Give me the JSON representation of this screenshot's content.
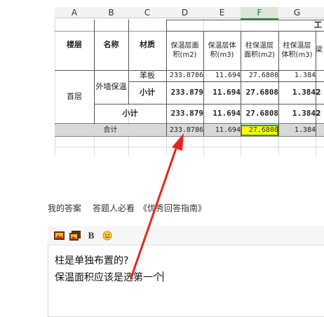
{
  "sheet": {
    "columns": [
      "A",
      "B",
      "C",
      "D",
      "E",
      "F",
      "G"
    ],
    "selected_column": "F",
    "header": {
      "group_label_partial": "工",
      "floor": "楼层",
      "name": "名称",
      "material": "材质",
      "d": [
        "保温层面",
        "积(m2)"
      ],
      "e": [
        "保温层体",
        "积(m3)"
      ],
      "f": [
        "柱保温层",
        "面积(m2)"
      ],
      "g": [
        "柱保温层",
        "体积(m3)"
      ],
      "h_partial": "梁"
    },
    "rows": {
      "floor_label": "首层",
      "wall_label": "外墙保温",
      "board": {
        "material": "苯板",
        "d": "233.8786",
        "e": "11.694",
        "f": "27.6808",
        "g": "1.384"
      },
      "subtotal1": {
        "label": "小计",
        "d": "233.879",
        "e": "11.694",
        "f": "27.6808",
        "g": "1.384",
        "h": "2"
      },
      "subtotal2": {
        "label": "小计",
        "d": "233.879",
        "e": "11.694",
        "f": "27.6808",
        "g": "1.384",
        "h": "2"
      },
      "total": {
        "label": "合计",
        "d": "233.8786",
        "e": "11.694",
        "f": "27.6808",
        "g": "1.384"
      }
    },
    "highlight_color": "#ffff00",
    "selection_color": "#2e9a3e"
  },
  "annotation": {
    "arrow_color": "#e8251c"
  },
  "qa_links": {
    "my_answer": "我的答案",
    "must_read": "答题人必看",
    "guide": "《优秀回答指南》"
  },
  "editor": {
    "toolbar": {
      "image": "image-icon",
      "multi_image": "multi-image-icon",
      "bold": "B",
      "emoji": "emoji-icon"
    },
    "lines": [
      "柱是单独布置的?",
      "保温面积应该是选第一个"
    ]
  }
}
